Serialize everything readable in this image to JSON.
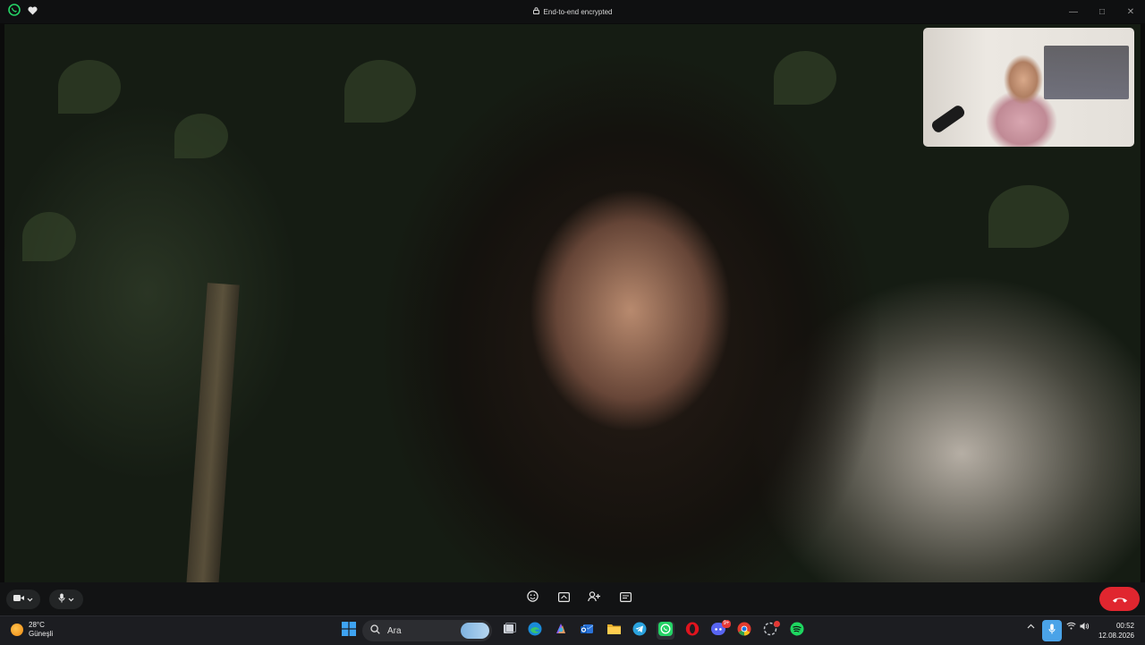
{
  "titlebar": {
    "encryption_label": "End-to-end encrypted"
  },
  "call_controls": {
    "camera": "video-icon",
    "microphone": "mic-icon",
    "emoji": "emoji-icon",
    "share_screen": "share-screen-icon",
    "add_participant": "add-person-icon",
    "chat": "chat-icon",
    "end_call": "end-call-icon",
    "end_call_color": "#e0262f"
  },
  "taskbar": {
    "weather": {
      "temperature": "28°C",
      "condition": "Güneşli"
    },
    "search_label": "Ara",
    "clock": {
      "time": "00:52",
      "date": "12.08.2026"
    },
    "pinned_apps": [
      "windows-start",
      "search",
      "task-view",
      "edge",
      "copilot",
      "outlook",
      "file-explorer",
      "telegram",
      "whatsapp",
      "opera",
      "discord",
      "chrome",
      "app",
      "spotify"
    ],
    "discord_badge": "9+"
  },
  "colors": {
    "whatsapp_green": "#25d366",
    "tray_mic_highlight": "#4aa3e8"
  }
}
